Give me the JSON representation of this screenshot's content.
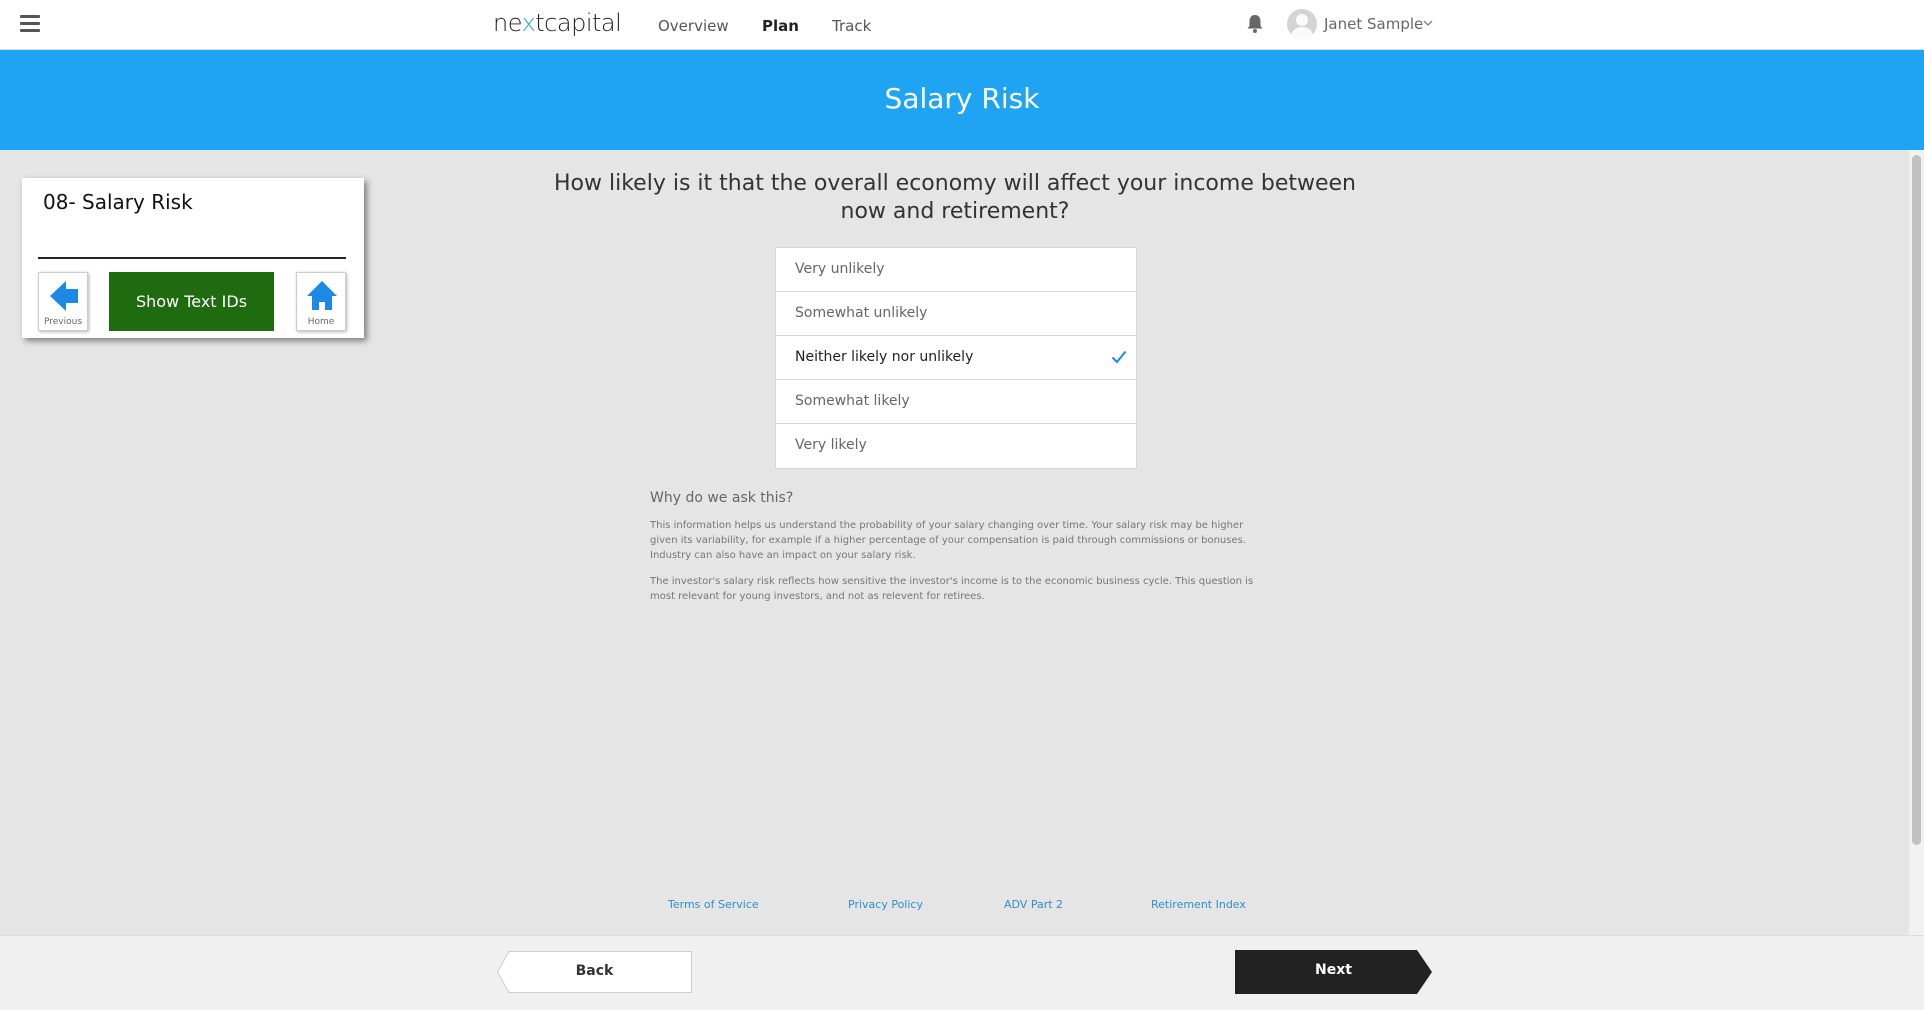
{
  "nav": {
    "logo_pre": "ne",
    "logo_x": "x",
    "logo_post": "tcapital",
    "links": [
      "Overview",
      "Plan",
      "Track"
    ],
    "active": "Plan",
    "user_name": "Janet Sample"
  },
  "header": {
    "title": "Salary Risk"
  },
  "panel": {
    "title": "08- Salary Risk",
    "previous_label": "Previous",
    "show_ids_label": "Show Text IDs",
    "home_label": "Home"
  },
  "question": {
    "text": "How likely is it that the overall economy will affect your income between now and retirement?",
    "options": [
      "Very unlikely",
      "Somewhat unlikely",
      "Neither likely nor unlikely",
      "Somewhat likely",
      "Very likely"
    ],
    "selected": "Neither likely nor unlikely"
  },
  "why": {
    "title": "Why do we ask this?",
    "paragraph1": "This information helps us understand the probability of your salary changing over time. Your salary risk may be higher given its variability, for example if a higher percentage of your compensation is paid through commissions or bonuses. Industry can also have an impact on your salary risk.",
    "paragraph2": "The investor's salary risk reflects how sensitive the investor's income is to the economic business cycle. This question is most relevant for young investors, and not as relevent for retirees."
  },
  "footer": {
    "links": [
      "Terms of Service",
      "Privacy Policy",
      "ADV Part 2",
      "Retirement Index"
    ]
  },
  "buttons": {
    "back": "Back",
    "next": "Next"
  },
  "colors": {
    "header_blue": "#1ea4f2",
    "show_ids_green": "#1e6b10",
    "link_blue": "#2a8fd4",
    "next_dark": "#222222"
  },
  "icons": {
    "menu": "hamburger-icon",
    "bell": "bell-icon",
    "avatar": "user-avatar-icon",
    "chevron": "chevron-down-icon",
    "previous": "arrow-left-icon",
    "home": "home-icon",
    "check": "checkmark-icon"
  }
}
